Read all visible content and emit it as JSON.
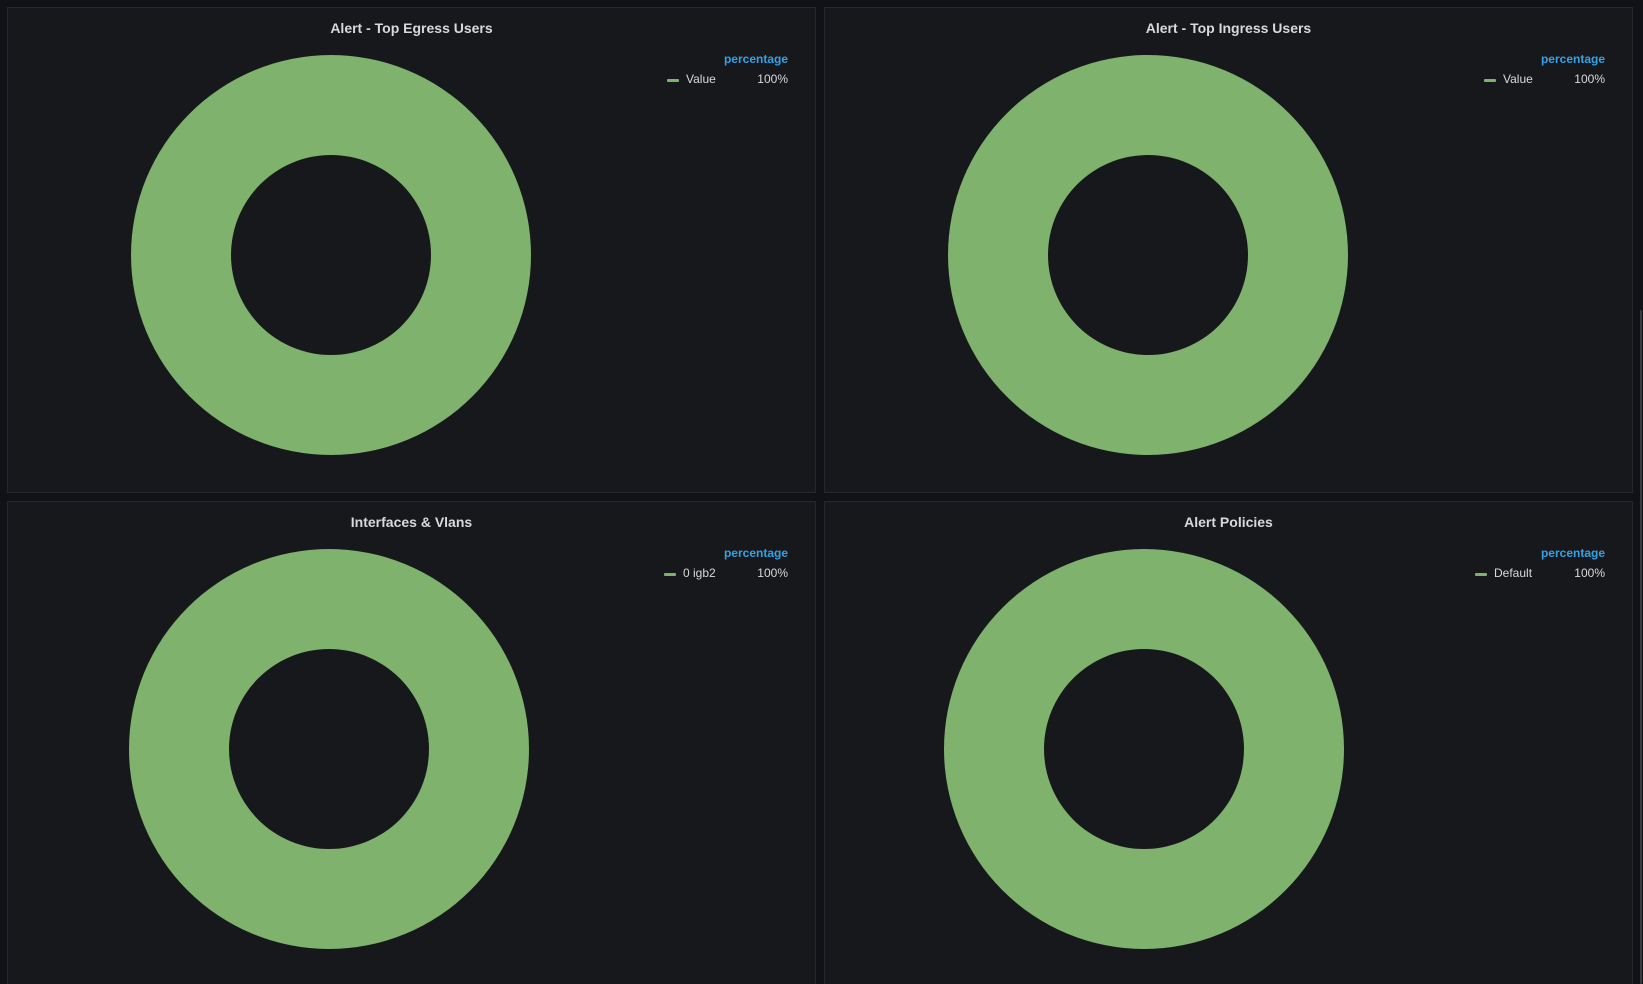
{
  "panels": [
    {
      "title": "Alert - Top Egress Users",
      "legend_header": "percentage",
      "legend_items": [
        {
          "name": "Value",
          "value": "100%"
        }
      ]
    },
    {
      "title": "Alert - Top Ingress Users",
      "legend_header": "percentage",
      "legend_items": [
        {
          "name": "Value",
          "value": "100%"
        }
      ]
    },
    {
      "title": "Interfaces & Vlans",
      "legend_header": "percentage",
      "legend_items": [
        {
          "name": "0 igb2",
          "value": "100%"
        }
      ]
    },
    {
      "title": "Alert Policies",
      "legend_header": "percentage",
      "legend_items": [
        {
          "name": "Default",
          "value": "100%"
        }
      ]
    }
  ],
  "chart_data": [
    {
      "type": "pie",
      "title": "Alert - Top Egress Users",
      "slices": [
        {
          "label": "Value",
          "value": 100
        }
      ],
      "legend_placement": "top-right"
    },
    {
      "type": "pie",
      "title": "Alert - Top Ingress Users",
      "slices": [
        {
          "label": "Value",
          "value": 100
        }
      ],
      "legend_placement": "top-right"
    },
    {
      "type": "pie",
      "title": "Interfaces & Vlans",
      "slices": [
        {
          "label": "0 igb2",
          "value": 100
        }
      ],
      "legend_placement": "top-right"
    },
    {
      "type": "pie",
      "title": "Alert Policies",
      "slices": [
        {
          "label": "Default",
          "value": 100
        }
      ],
      "legend_placement": "top-right"
    }
  ],
  "colors": {
    "slice": "#7eb26d",
    "legend_header": "#33a2e5",
    "panel_bg": "#17181c",
    "page_bg": "#111217"
  }
}
